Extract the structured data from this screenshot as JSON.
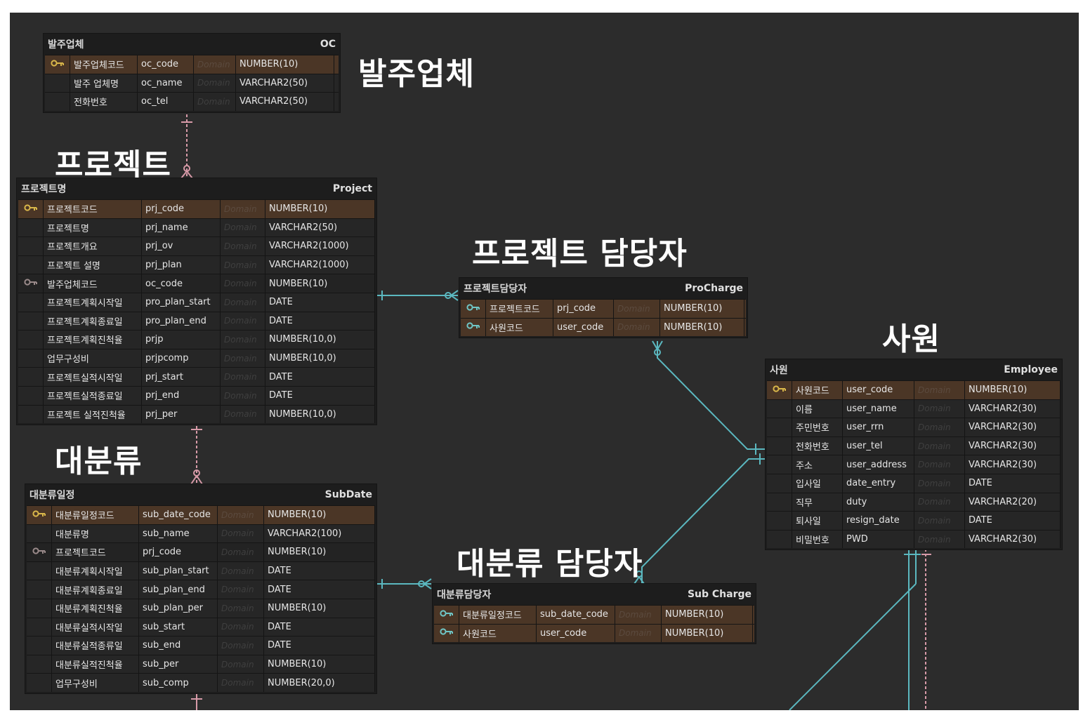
{
  "labels": {
    "oc": "발주업체",
    "project": "프로젝트",
    "procharge": "프로젝트 담당자",
    "employee": "사원",
    "subdate": "대분류",
    "subcharge": "대분류 담당자"
  },
  "colors": {
    "background": "#2c2c2c",
    "entity_body": "#1d1d1d",
    "pk_row": "#4b3626",
    "pk_key": "#d9b74a",
    "fk_key": "#9a8a8a",
    "pf_key": "#6fc6c6",
    "relation_line": "#5bb8c0",
    "identifying_line": "#d79aa8"
  },
  "entities": [
    {
      "id": "oc",
      "logical": "발주업체",
      "physical": "OC",
      "rows": [
        {
          "icon": "pk",
          "logical": "발주업체코드",
          "physical": "oc_code",
          "domain": "Domain",
          "type": "NUMBER(10)"
        },
        {
          "icon": "",
          "logical": "발주 업체명",
          "physical": "oc_name",
          "domain": "Domain",
          "type": "VARCHAR2(50)"
        },
        {
          "icon": "",
          "logical": "전화번호",
          "physical": "oc_tel",
          "domain": "Domain",
          "type": "VARCHAR2(50)"
        }
      ]
    },
    {
      "id": "project",
      "logical": "프로젝트명",
      "physical": "Project",
      "rows": [
        {
          "icon": "pk",
          "logical": "프로젝트코드",
          "physical": "prj_code",
          "domain": "Domain",
          "type": "NUMBER(10)"
        },
        {
          "icon": "",
          "logical": "프로젝트명",
          "physical": "prj_name",
          "domain": "Domain",
          "type": "VARCHAR2(50)"
        },
        {
          "icon": "",
          "logical": "프로젝트개요",
          "physical": "prj_ov",
          "domain": "Domain",
          "type": "VARCHAR2(1000)"
        },
        {
          "icon": "",
          "logical": "프로젝트 설명",
          "physical": "prj_plan",
          "domain": "Domain",
          "type": "VARCHAR2(1000)"
        },
        {
          "icon": "fk",
          "logical": "발주업체코드",
          "physical": "oc_code",
          "domain": "Domain",
          "type": "NUMBER(10)"
        },
        {
          "icon": "",
          "logical": "프로젝트계획시작일",
          "physical": "pro_plan_start",
          "domain": "Domain",
          "type": "DATE"
        },
        {
          "icon": "",
          "logical": "프로젝트계획종료일",
          "physical": "pro_plan_end",
          "domain": "Domain",
          "type": "DATE"
        },
        {
          "icon": "",
          "logical": "프로젝트계획진척율",
          "physical": "prjp",
          "domain": "Domain",
          "type": "NUMBER(10,0)"
        },
        {
          "icon": "",
          "logical": "업무구성비",
          "physical": "prjpcomp",
          "domain": "Domain",
          "type": "NUMBER(10,0)"
        },
        {
          "icon": "",
          "logical": "프로젝트실적시작일",
          "physical": "prj_start",
          "domain": "Domain",
          "type": "DATE"
        },
        {
          "icon": "",
          "logical": "프로젝트실적종료일",
          "physical": "prj_end",
          "domain": "Domain",
          "type": "DATE"
        },
        {
          "icon": "",
          "logical": "프로젝트 실적진척율",
          "physical": "prj_per",
          "domain": "Domain",
          "type": "NUMBER(10,0)"
        }
      ]
    },
    {
      "id": "procharge",
      "logical": "프로젝트담당자",
      "physical": "ProCharge",
      "rows": [
        {
          "icon": "pf",
          "logical": "프로젝트코드",
          "physical": "prj_code",
          "domain": "Domain",
          "type": "NUMBER(10)"
        },
        {
          "icon": "pf",
          "logical": "사원코드",
          "physical": "user_code",
          "domain": "Domain",
          "type": "NUMBER(10)"
        }
      ]
    },
    {
      "id": "employee",
      "logical": "사원",
      "physical": "Employee",
      "rows": [
        {
          "icon": "pk",
          "logical": "사원코드",
          "physical": "user_code",
          "domain": "Domain",
          "type": "NUMBER(10)"
        },
        {
          "icon": "",
          "logical": "이름",
          "physical": "user_name",
          "domain": "Domain",
          "type": "VARCHAR2(30)"
        },
        {
          "icon": "",
          "logical": "주민번호",
          "physical": "user_rrn",
          "domain": "Domain",
          "type": "VARCHAR2(30)"
        },
        {
          "icon": "",
          "logical": "전화번호",
          "physical": "user_tel",
          "domain": "Domain",
          "type": "VARCHAR2(30)"
        },
        {
          "icon": "",
          "logical": "주소",
          "physical": "user_address",
          "domain": "Domain",
          "type": "VARCHAR2(30)"
        },
        {
          "icon": "",
          "logical": "입사일",
          "physical": "date_entry",
          "domain": "Domain",
          "type": "DATE"
        },
        {
          "icon": "",
          "logical": "직무",
          "physical": "duty",
          "domain": "Domain",
          "type": "VARCHAR2(20)"
        },
        {
          "icon": "",
          "logical": "퇴사일",
          "physical": "resign_date",
          "domain": "Domain",
          "type": "DATE"
        },
        {
          "icon": "",
          "logical": "비밀번호",
          "physical": "PWD",
          "domain": "Domain",
          "type": "VARCHAR2(30)"
        }
      ]
    },
    {
      "id": "subdate",
      "logical": "대분류일정",
      "physical": "SubDate",
      "rows": [
        {
          "icon": "pk",
          "logical": "대분류일정코드",
          "physical": "sub_date_code",
          "domain": "Domain",
          "type": "NUMBER(10)"
        },
        {
          "icon": "",
          "logical": "대분류명",
          "physical": "sub_name",
          "domain": "Domain",
          "type": "VARCHAR2(100)"
        },
        {
          "icon": "fk",
          "logical": "프로젝트코드",
          "physical": "prj_code",
          "domain": "Domain",
          "type": "NUMBER(10)"
        },
        {
          "icon": "",
          "logical": "대분류계획시작일",
          "physical": "sub_plan_start",
          "domain": "Domain",
          "type": "DATE"
        },
        {
          "icon": "",
          "logical": "대분류계획종료일",
          "physical": "sub_plan_end",
          "domain": "Domain",
          "type": "DATE"
        },
        {
          "icon": "",
          "logical": "대분류계획진척율",
          "physical": "sub_plan_per",
          "domain": "Domain",
          "type": "NUMBER(10)"
        },
        {
          "icon": "",
          "logical": "대분류실적시작일",
          "physical": "sub_start",
          "domain": "Domain",
          "type": "DATE"
        },
        {
          "icon": "",
          "logical": "대분류실적종류일",
          "physical": "sub_end",
          "domain": "Domain",
          "type": "DATE"
        },
        {
          "icon": "",
          "logical": "대분류실적진척율",
          "physical": "sub_per",
          "domain": "Domain",
          "type": "NUMBER(10)"
        },
        {
          "icon": "",
          "logical": "업무구성비",
          "physical": "sub_comp",
          "domain": "Domain",
          "type": "NUMBER(20,0)"
        }
      ]
    },
    {
      "id": "subcharge",
      "logical": "대분류담당자",
      "physical": "Sub Charge",
      "rows": [
        {
          "icon": "pf",
          "logical": "대분류일정코드",
          "physical": "sub_date_code",
          "domain": "Domain",
          "type": "NUMBER(10)"
        },
        {
          "icon": "pf",
          "logical": "사원코드",
          "physical": "user_code",
          "domain": "Domain",
          "type": "NUMBER(10)"
        }
      ]
    }
  ]
}
